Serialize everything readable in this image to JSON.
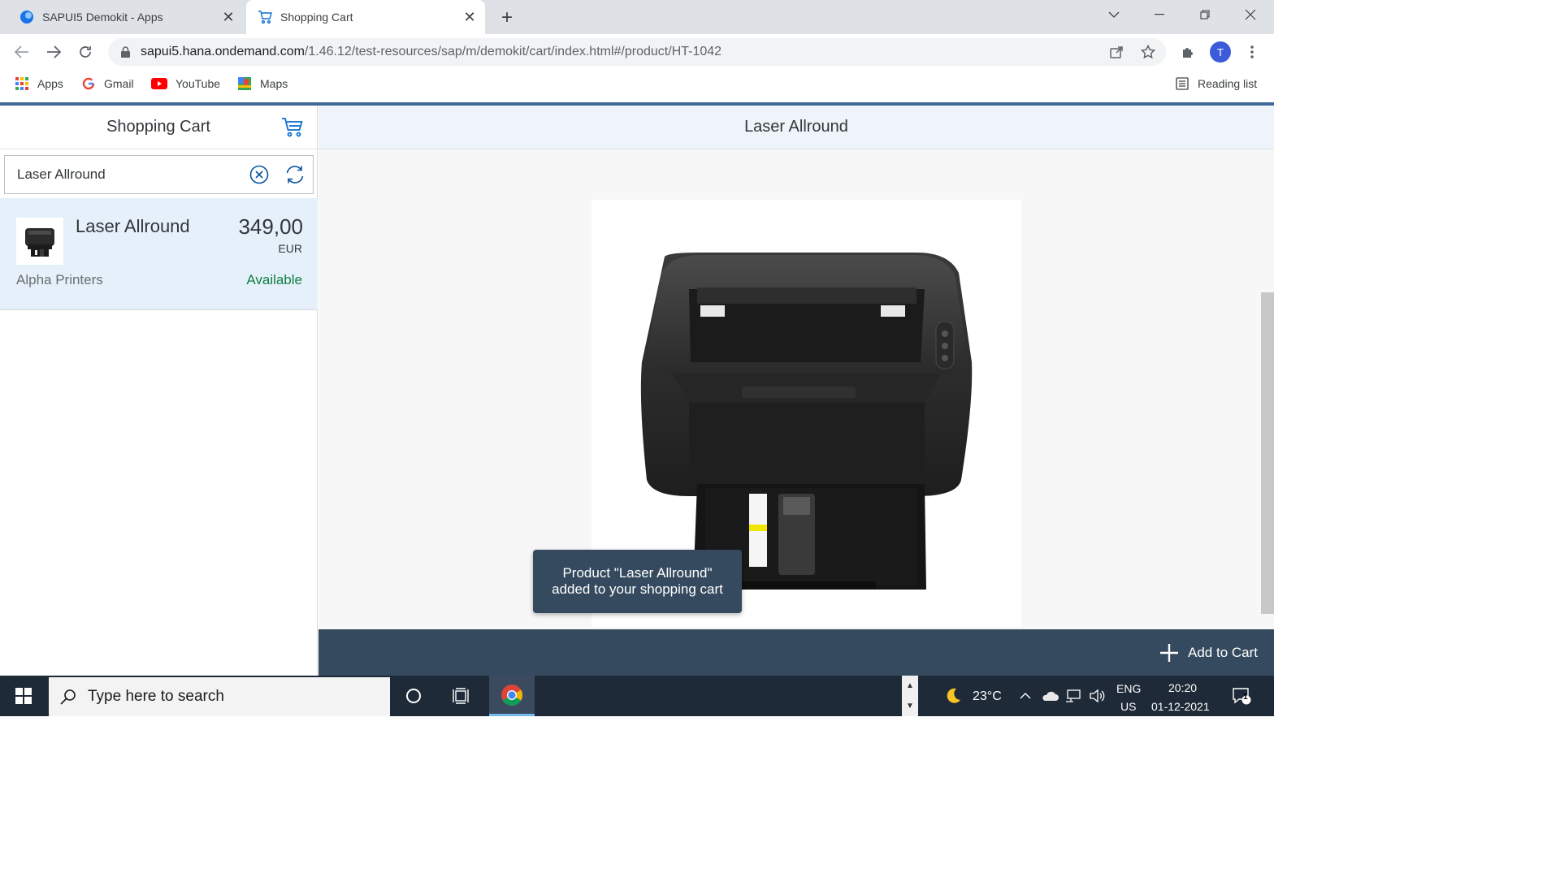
{
  "browser": {
    "tabs": [
      {
        "title": "SAPUI5 Demokit - Apps",
        "active": false
      },
      {
        "title": "Shopping Cart",
        "active": true
      }
    ],
    "url_host": "sapui5.hana.ondemand.com",
    "url_path": "/1.46.12/test-resources/sap/m/demokit/cart/index.html#/product/HT-1042",
    "profile_initial": "T",
    "bookmarks": [
      "Apps",
      "Gmail",
      "YouTube",
      "Maps"
    ],
    "reading_list": "Reading list"
  },
  "master": {
    "title": "Shopping Cart",
    "search_value": "Laser Allround",
    "items": [
      {
        "name": "Laser Allround",
        "price": "349,00",
        "currency": "EUR",
        "supplier": "Alpha Printers",
        "status": "Available"
      }
    ]
  },
  "detail": {
    "title": "Laser Allround",
    "add_button": "Add to Cart",
    "toast_line1": "Product \"Laser Allround\"",
    "toast_line2": "added to your shopping cart"
  },
  "taskbar": {
    "search_placeholder": "Type here to search",
    "temperature": "23°C",
    "lang_top": "ENG",
    "lang_bottom": "US",
    "time": "20:20",
    "date": "01-12-2021",
    "notifications": "1"
  },
  "colors": {
    "shell_blue": "#3f6a98",
    "selected_row": "#e5f0fa",
    "status_green": "#107e3e",
    "footer": "#354a5f"
  }
}
